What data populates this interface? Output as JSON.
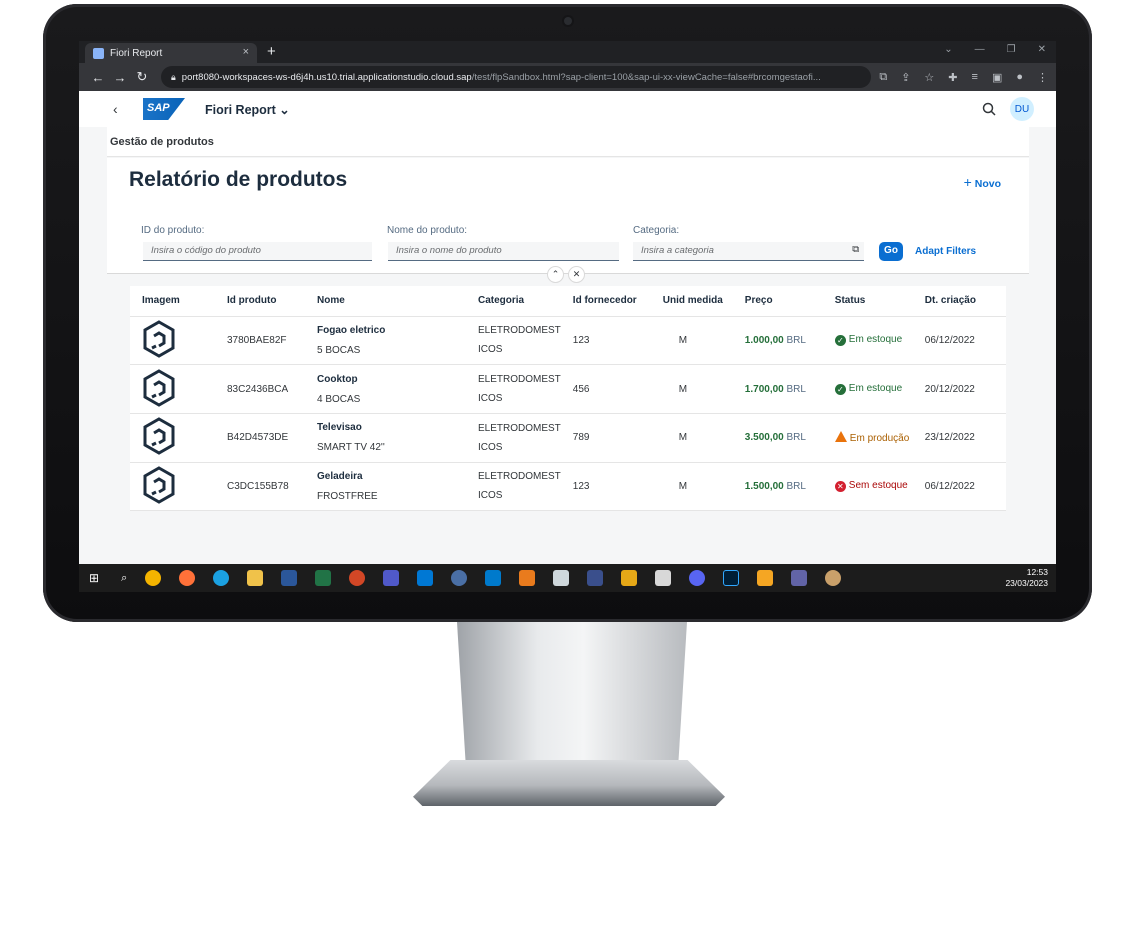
{
  "browser": {
    "tab_title": "Fiori Report",
    "tab_close": "×",
    "new_tab": "+",
    "url_host": "port8080-workspaces-ws-d6j4h.us10.trial.applicationstudio.cloud.sap",
    "url_path": "/test/flpSandbox.html?sap-client=100&sap-ui-xx-viewCache=false#brcomgestaofi..."
  },
  "shell": {
    "logo": "SAP",
    "app_title": "Fiori Report ⌄",
    "avatar": "DU"
  },
  "page": {
    "breadcrumb": "Gestão de produtos",
    "title": "Relatório de produtos",
    "new_button": "Novo"
  },
  "filters": {
    "id_label": "ID do produto:",
    "id_placeholder": "Insira o código do produto",
    "name_label": "Nome do produto:",
    "name_placeholder": "Insira o nome do produto",
    "category_label": "Categoria:",
    "category_placeholder": "Insira a categoria",
    "go": "Go",
    "adapt": "Adapt Filters"
  },
  "table": {
    "headers": [
      "Imagem",
      "Id produto",
      "Nome",
      "Categoria",
      "Id fornecedor",
      "Unid medida",
      "Preço",
      "Status",
      "Dt. criação"
    ],
    "rows": [
      {
        "id": "3780BAE82F",
        "name": "Fogao eletrico",
        "desc": "5 BOCAS",
        "cat1": "ELETRODOMEST",
        "cat2": "ICOS",
        "supplier": "123",
        "unit": "M",
        "price": "1.000,00",
        "currency": "BRL",
        "status": "Em estoque",
        "date": "06/12/2022"
      },
      {
        "id": "83C2436BCA",
        "name": "Cooktop",
        "desc": "4 BOCAS",
        "cat1": "ELETRODOMEST",
        "cat2": "ICOS",
        "supplier": "456",
        "unit": "M",
        "price": "1.700,00",
        "currency": "BRL",
        "status": "Em estoque",
        "date": "20/12/2022"
      },
      {
        "id": "B42D4573DE",
        "name": "Televisao",
        "desc": "SMART TV 42''",
        "cat1": "ELETRODOMEST",
        "cat2": "ICOS",
        "supplier": "789",
        "unit": "M",
        "price": "3.500,00",
        "currency": "BRL",
        "status": "Em produção",
        "date": "23/12/2022"
      },
      {
        "id": "C3DC155B78",
        "name": "Geladeira",
        "desc": "FROSTFREE",
        "cat1": "ELETRODOMEST",
        "cat2": "ICOS",
        "supplier": "123",
        "unit": "M",
        "price": "1.500,00",
        "currency": "BRL",
        "status": "Sem estoque",
        "date": "06/12/2022"
      }
    ]
  },
  "taskbar": {
    "time": "12:53",
    "date": "23/03/2023"
  }
}
